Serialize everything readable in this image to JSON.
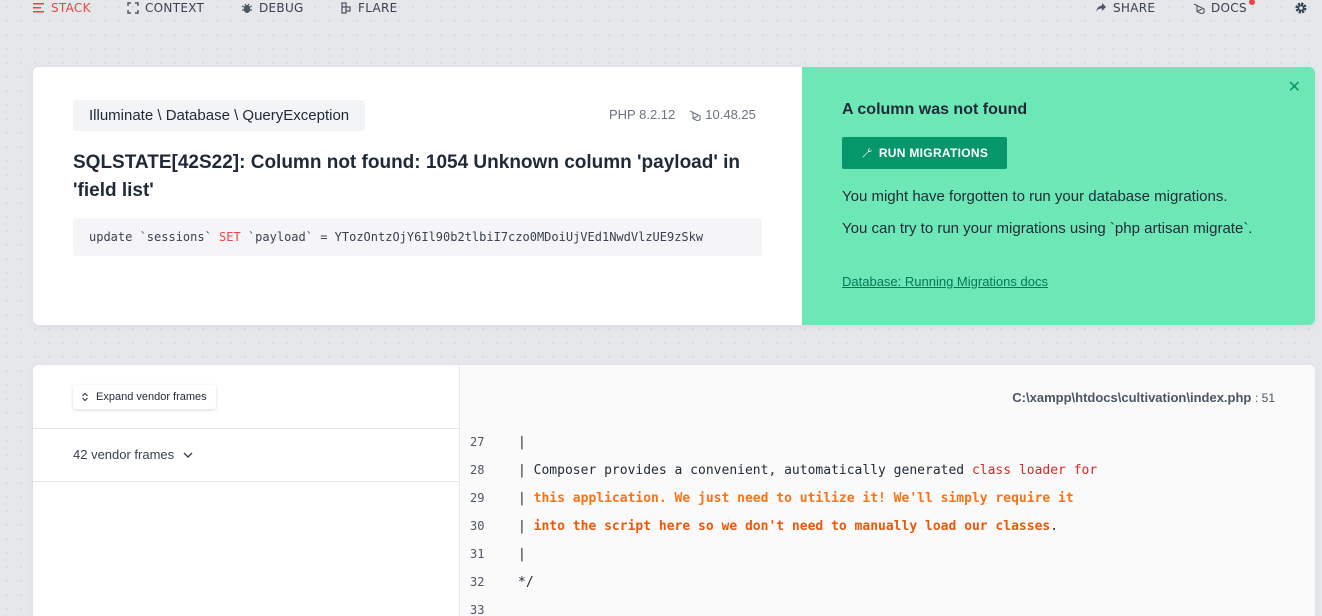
{
  "nav": {
    "stack": "STACK",
    "context": "CONTEXT",
    "debug": "DEBUG",
    "flare": "FLARE",
    "share": "SHARE",
    "docs": "DOCS"
  },
  "exception": {
    "class": "Illuminate \\ Database \\ QueryException",
    "php_version": "PHP 8.2.12",
    "laravel_version": "10.48.25",
    "message": "SQLSTATE[42S22]: Column not found: 1054 Unknown column 'payload' in 'field list'",
    "sql_pre": "update `sessions` ",
    "sql_kw": "SET",
    "sql_post": " `payload` = YTozOntzOjY6Il90b2tlbiI7czo0MDoiUjVEd1NwdVlzUE9zSkw"
  },
  "solution": {
    "title": "A column was not found",
    "button": "RUN MIGRATIONS",
    "p1": "You might have forgotten to run your database migrations.",
    "p2": "You can try to run your migrations using `php artisan migrate`.",
    "link": "Database: Running Migrations docs"
  },
  "frames": {
    "expand_label": "Expand vendor frames",
    "vendor_count": "42 vendor frames"
  },
  "code": {
    "file": "C:\\xampp\\htdocs\\cultivation\\index.php",
    "line_ref": ": 51",
    "lines": [
      {
        "n": "27",
        "a": "|",
        "b": "",
        "c": "",
        "d": ""
      },
      {
        "n": "28",
        "a": "| Composer provides a convenient, automatically generated ",
        "b": "class loader for",
        "c": "",
        "d": ""
      },
      {
        "n": "29",
        "a": "| ",
        "b": "",
        "c": "this application. We just need to utilize it! We'll simply require it",
        "d": ""
      },
      {
        "n": "30",
        "a": "| ",
        "b": "",
        "c": "into the script here so we don't need to manually load our classes",
        "d": "."
      },
      {
        "n": "31",
        "a": "|",
        "b": "",
        "c": "",
        "d": ""
      },
      {
        "n": "32",
        "a": "*/",
        "b": "",
        "c": "",
        "d": ""
      },
      {
        "n": "33",
        "a": "",
        "b": "",
        "c": "",
        "d": ""
      }
    ]
  },
  "colors": {
    "accent_red": "#ef4444",
    "solution_bg": "#6ee7b7",
    "button_green": "#059669"
  }
}
